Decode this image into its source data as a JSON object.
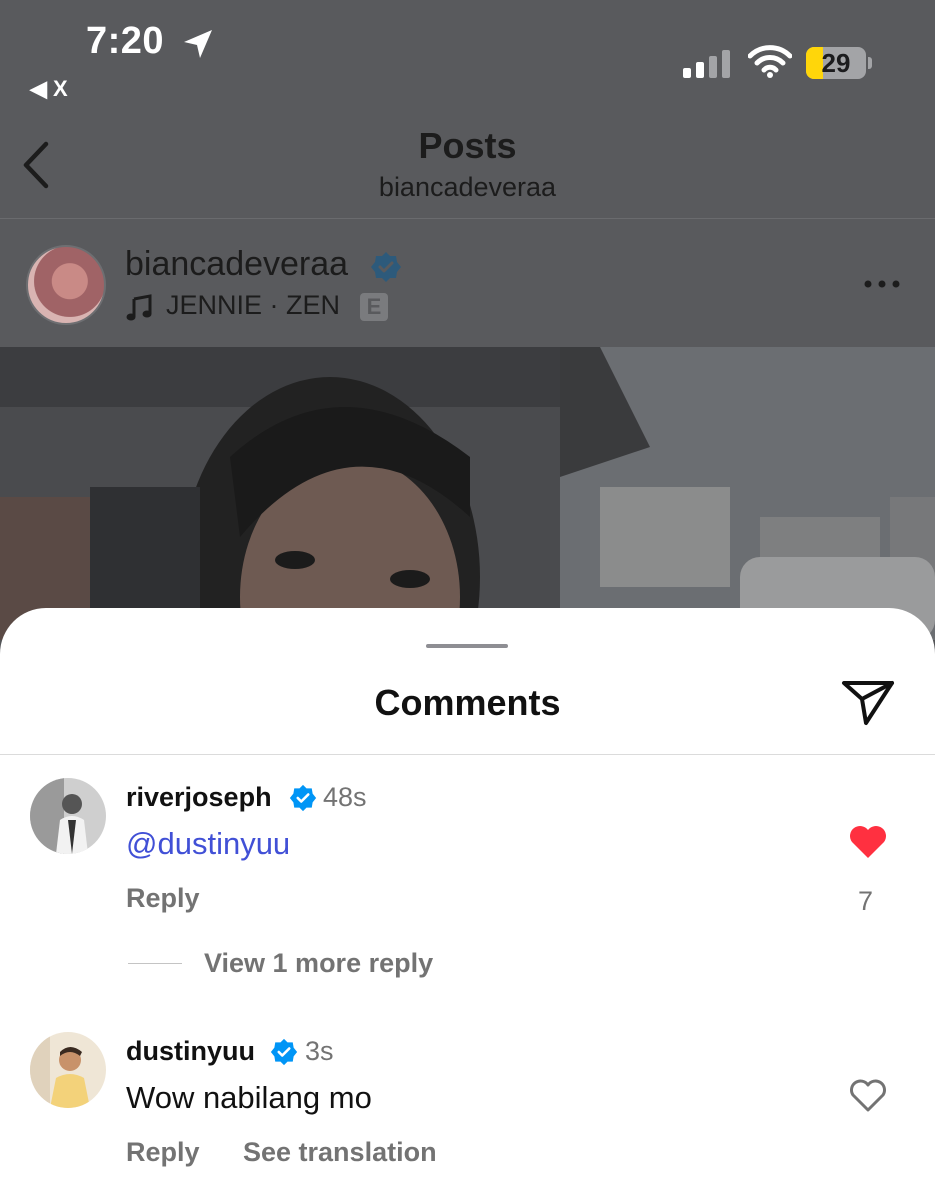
{
  "status_bar": {
    "time": "7:20",
    "back_app": "◀ X",
    "battery": "29",
    "battery_level": 0.29,
    "battery_color": "#ffd60a"
  },
  "header": {
    "title": "Posts",
    "subtitle": "biancadeveraa"
  },
  "post": {
    "author": "biancadeveraa",
    "music": "JENNIE · ZEN",
    "explicit_badge": "E",
    "more_icon": "more-horizontal-icon"
  },
  "sheet": {
    "title": "Comments",
    "share_icon": "paper-plane-icon",
    "comments": [
      {
        "user": "riverjoseph",
        "time": "48s",
        "mention": "@dustinyuu",
        "text": "",
        "liked": true,
        "like_count": "7",
        "reply_label": "Reply",
        "view_replies": "View 1 more reply"
      },
      {
        "user": "dustinyuu",
        "time": "3s",
        "text": "Wow nabilang mo",
        "liked": false,
        "reply_label": "Reply",
        "translate_label": "See translation"
      }
    ]
  },
  "colors": {
    "like": "#ff3040",
    "mention": "#4150d6",
    "verified": "#0095f6",
    "overlay": "#595a5d"
  }
}
